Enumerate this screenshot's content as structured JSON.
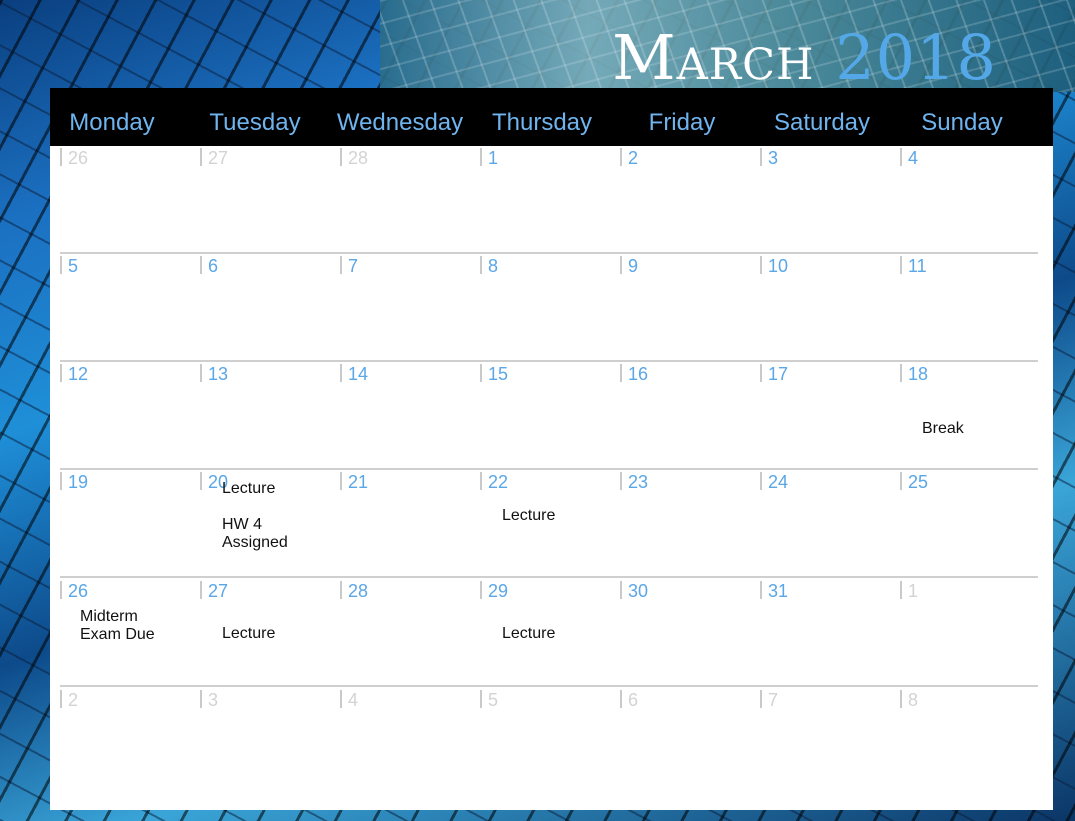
{
  "title": {
    "month": "March",
    "year": "2018"
  },
  "colors": {
    "accent": "#55a8e8",
    "header_bg": "#000000",
    "other_month": "#d3d3d3"
  },
  "weekdays": [
    "Monday",
    "Tuesday",
    "Wednesday",
    "Thursday",
    "Friday",
    "Saturday",
    "Sunday"
  ],
  "weeks": [
    [
      {
        "day": "26",
        "current": false
      },
      {
        "day": "27",
        "current": false
      },
      {
        "day": "28",
        "current": false
      },
      {
        "day": "1",
        "current": true
      },
      {
        "day": "2",
        "current": true
      },
      {
        "day": "3",
        "current": true
      },
      {
        "day": "4",
        "current": true
      }
    ],
    [
      {
        "day": "5",
        "current": true
      },
      {
        "day": "6",
        "current": true
      },
      {
        "day": "7",
        "current": true
      },
      {
        "day": "8",
        "current": true
      },
      {
        "day": "9",
        "current": true
      },
      {
        "day": "10",
        "current": true
      },
      {
        "day": "11",
        "current": true
      }
    ],
    [
      {
        "day": "12",
        "current": true
      },
      {
        "day": "13",
        "current": true
      },
      {
        "day": "14",
        "current": true
      },
      {
        "day": "15",
        "current": true
      },
      {
        "day": "16",
        "current": true
      },
      {
        "day": "17",
        "current": true
      },
      {
        "day": "18",
        "current": true,
        "events": [
          "Break"
        ]
      }
    ],
    [
      {
        "day": "19",
        "current": true
      },
      {
        "day": "20",
        "current": true,
        "events": [
          "Lecture",
          "HW 4\nAssigned"
        ]
      },
      {
        "day": "21",
        "current": true
      },
      {
        "day": "22",
        "current": true,
        "events": [
          "Lecture"
        ]
      },
      {
        "day": "23",
        "current": true
      },
      {
        "day": "24",
        "current": true
      },
      {
        "day": "25",
        "current": true
      }
    ],
    [
      {
        "day": "26",
        "current": true,
        "events": [
          "Midterm\nExam Due"
        ]
      },
      {
        "day": "27",
        "current": true,
        "events": [
          "Lecture"
        ]
      },
      {
        "day": "28",
        "current": true
      },
      {
        "day": "29",
        "current": true,
        "events": [
          "Lecture"
        ]
      },
      {
        "day": "30",
        "current": true
      },
      {
        "day": "31",
        "current": true
      },
      {
        "day": "1",
        "current": false
      }
    ],
    [
      {
        "day": "2",
        "current": false
      },
      {
        "day": "3",
        "current": false
      },
      {
        "day": "4",
        "current": false
      },
      {
        "day": "5",
        "current": false
      },
      {
        "day": "6",
        "current": false
      },
      {
        "day": "7",
        "current": false
      },
      {
        "day": "8",
        "current": false
      }
    ]
  ]
}
